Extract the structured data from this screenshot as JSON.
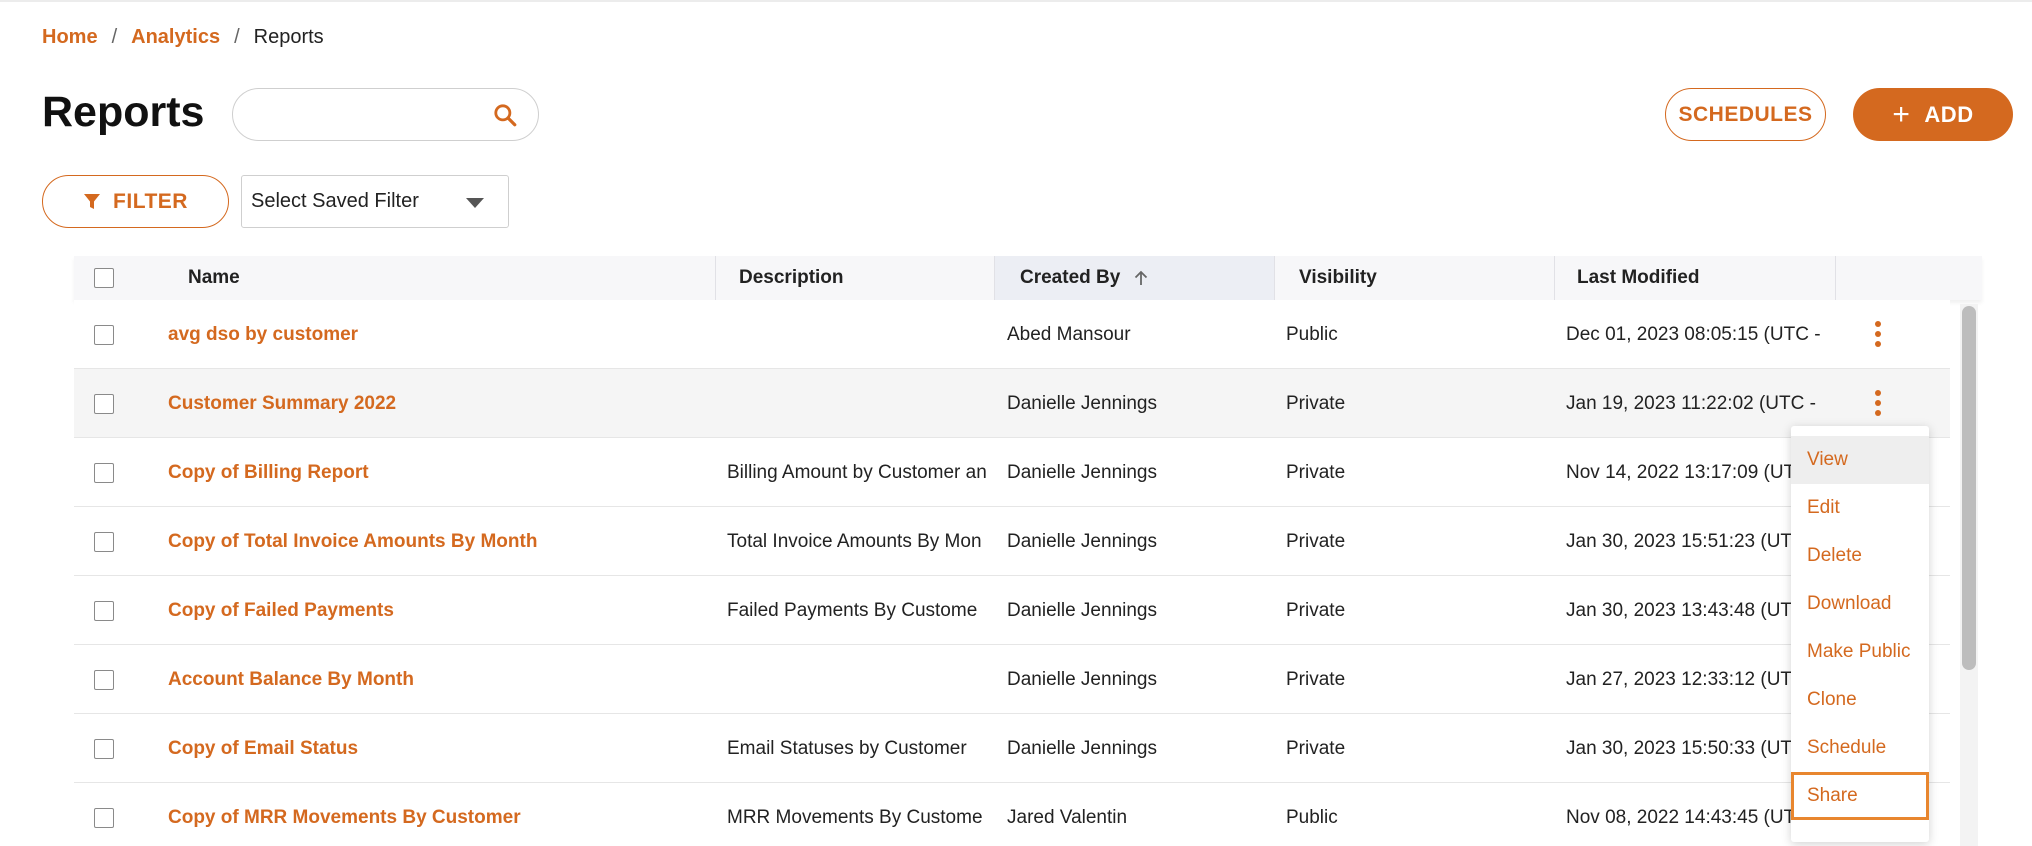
{
  "breadcrumb": {
    "home": "Home",
    "analytics": "Analytics",
    "current": "Reports",
    "separator": "/"
  },
  "page": {
    "title": "Reports",
    "search_value": "",
    "search_placeholder": ""
  },
  "buttons": {
    "schedules": "SCHEDULES",
    "add_plus": "+",
    "add": "ADD",
    "filter": "FILTER"
  },
  "saved_filter": {
    "selected": "Select Saved Filter"
  },
  "table": {
    "headers": {
      "name": "Name",
      "description": "Description",
      "created_by": "Created By",
      "visibility": "Visibility",
      "last_modified": "Last Modified"
    },
    "rows": [
      {
        "name": "avg dso by customer",
        "description": "",
        "created_by": "Abed Mansour",
        "visibility": "Public",
        "last_modified": "Dec 01, 2023 08:05:15 (UTC -"
      },
      {
        "name": "Customer Summary 2022",
        "description": "",
        "created_by": "Danielle Jennings",
        "visibility": "Private",
        "last_modified": "Jan 19, 2023 11:22:02 (UTC -"
      },
      {
        "name": "Copy of Billing Report",
        "description": "Billing Amount by Customer an",
        "created_by": "Danielle Jennings",
        "visibility": "Private",
        "last_modified": "Nov 14, 2022 13:17:09 (UTC -"
      },
      {
        "name": "Copy of Total Invoice Amounts By Month",
        "description": "Total Invoice Amounts By Mon",
        "created_by": "Danielle Jennings",
        "visibility": "Private",
        "last_modified": "Jan 30, 2023 15:51:23 (UTC -"
      },
      {
        "name": "Copy of Failed Payments",
        "description": "Failed Payments By Custome",
        "created_by": "Danielle Jennings",
        "visibility": "Private",
        "last_modified": "Jan 30, 2023 13:43:48 (UTC -"
      },
      {
        "name": "Account Balance By Month",
        "description": "",
        "created_by": "Danielle Jennings",
        "visibility": "Private",
        "last_modified": "Jan 27, 2023 12:33:12 (UTC -"
      },
      {
        "name": "Copy of Email Status",
        "description": "Email Statuses by Customer",
        "created_by": "Danielle Jennings",
        "visibility": "Private",
        "last_modified": "Jan 30, 2023 15:50:33 (UTC -"
      },
      {
        "name": "Copy of MRR Movements By Customer",
        "description": "MRR Movements By Custome",
        "created_by": "Jared Valentin",
        "visibility": "Public",
        "last_modified": "Nov 08, 2022 14:43:45 (UTC -"
      }
    ]
  },
  "context_menu": {
    "items": [
      "View",
      "Edit",
      "Delete",
      "Download",
      "Make Public",
      "Clone",
      "Schedule",
      "Share"
    ]
  },
  "colors": {
    "accent": "#d4691f",
    "focus_outline": "#e8862e",
    "header_bg": "#f7f7f9"
  },
  "icons": {
    "search": "search-icon",
    "filter": "funnel-icon",
    "sort": "arrow-up-icon",
    "row_actions": "kebab-icon",
    "dropdown": "caret-down-icon"
  }
}
